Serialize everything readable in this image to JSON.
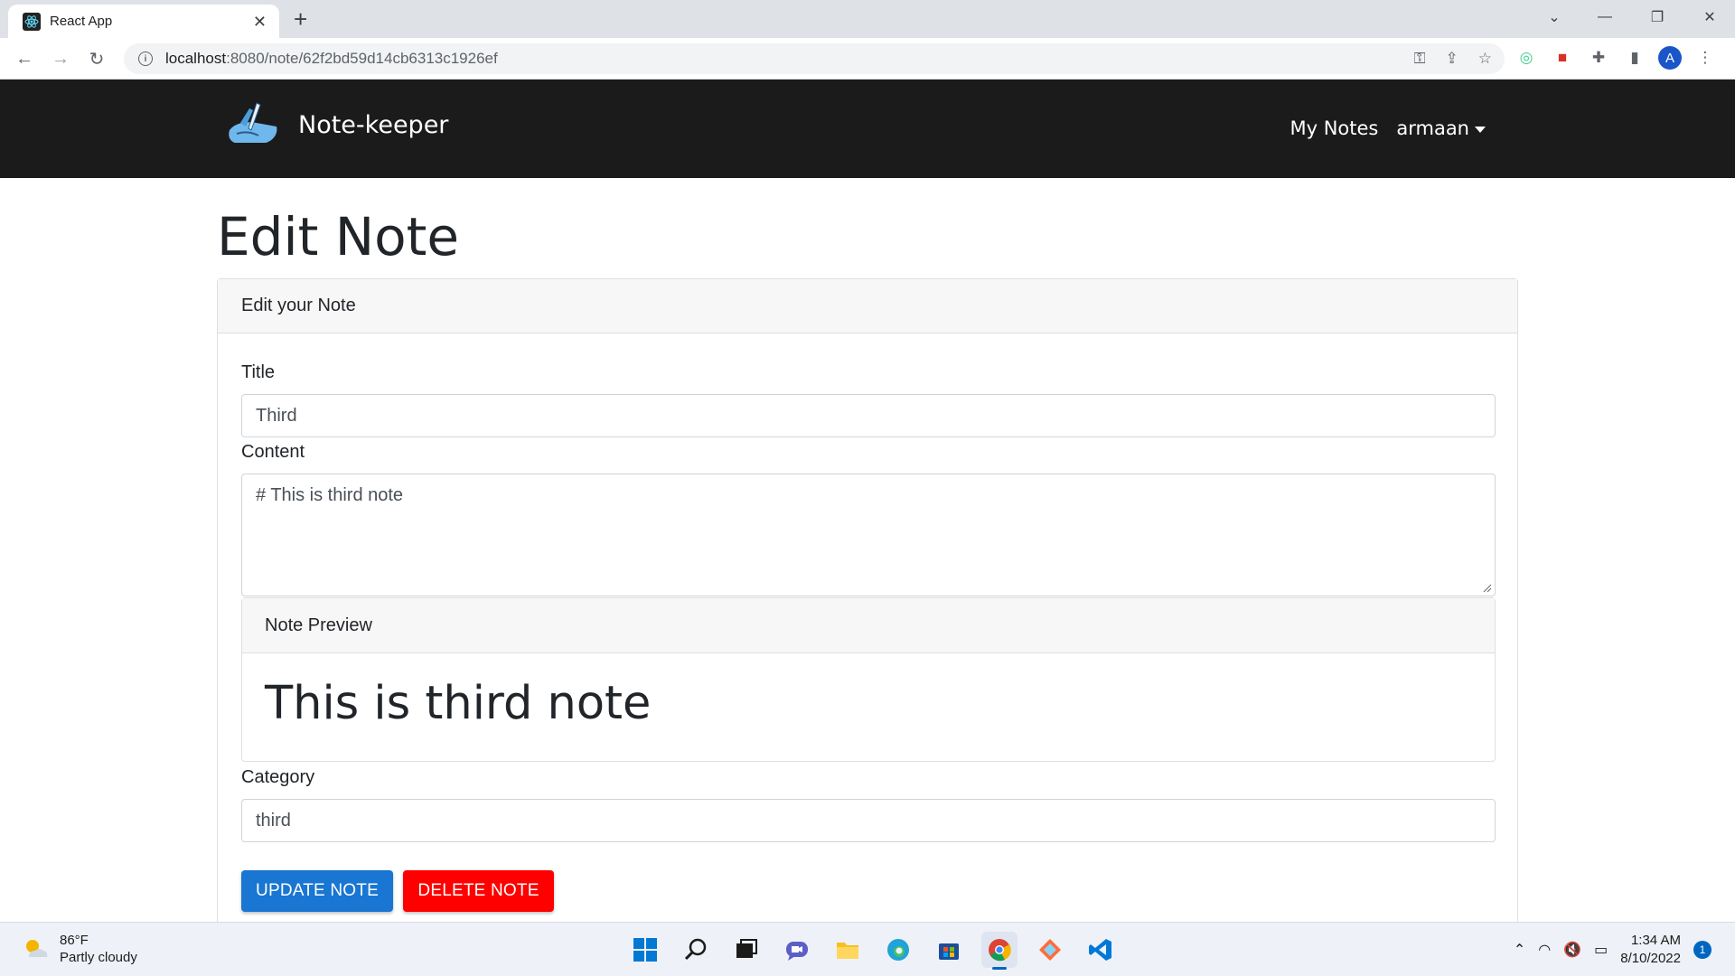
{
  "browser": {
    "tab_title": "React App",
    "url_host": "localhost",
    "url_rest": ":8080/note/62f2bd59d14cb6313c1926ef",
    "profile_initial": "A"
  },
  "app": {
    "brand": "Note-keeper",
    "nav": {
      "my_notes": "My Notes",
      "user": "armaan"
    }
  },
  "page": {
    "title": "Edit Note",
    "card_header": "Edit your Note",
    "form": {
      "title_label": "Title",
      "title_value": "Third",
      "content_label": "Content",
      "content_value": "# This is third note",
      "preview_header": "Note Preview",
      "preview_heading": "This is third note",
      "category_label": "Category",
      "category_value": "third"
    },
    "buttons": {
      "update": "UPDATE NOTE",
      "delete": "DELETE NOTE"
    }
  },
  "colors": {
    "navbar": "#1b1b1b",
    "update_button": "#1976d2",
    "delete_button": "#ff0000"
  },
  "taskbar": {
    "weather_temp": "86°F",
    "weather_desc": "Partly cloudy",
    "time": "1:34 AM",
    "date": "8/10/2022",
    "notification_count": "1",
    "pinned_icons": [
      "windows-start-icon",
      "search-icon",
      "task-view-icon",
      "chat-icon",
      "file-explorer-icon",
      "edge-icon",
      "store-icon",
      "chrome-icon",
      "app-icon",
      "vscode-icon"
    ]
  }
}
